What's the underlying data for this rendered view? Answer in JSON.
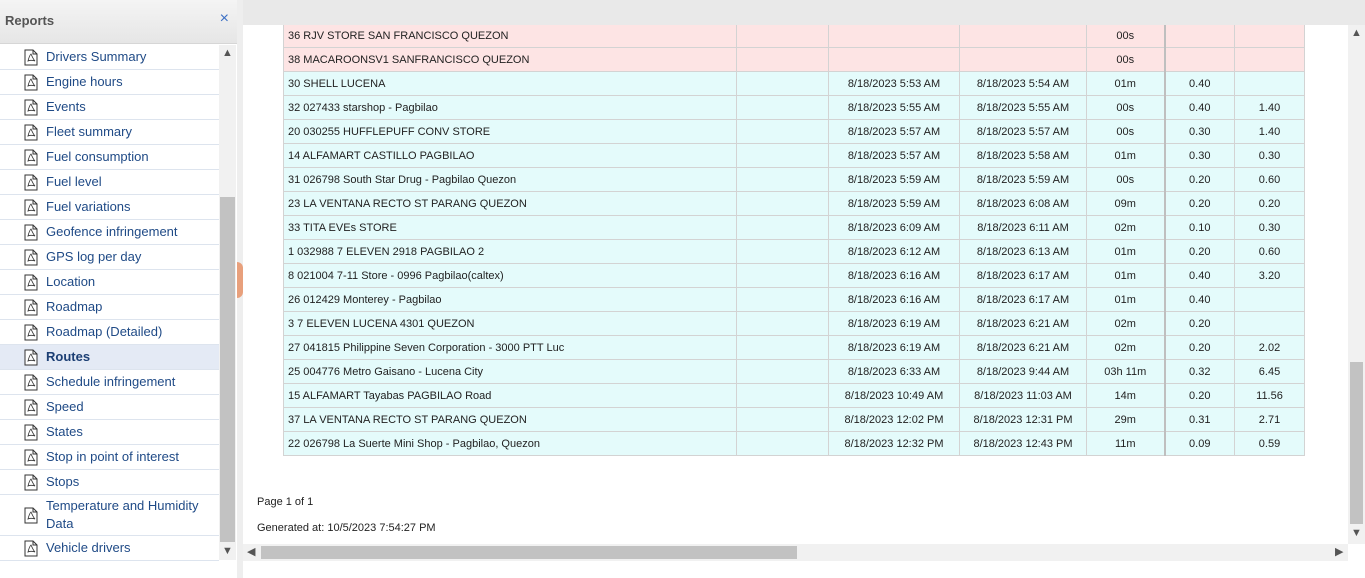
{
  "sidebar": {
    "title": "Reports",
    "close_glyph": "×",
    "items": [
      {
        "label": "Drivers Summary"
      },
      {
        "label": "Engine hours"
      },
      {
        "label": "Events"
      },
      {
        "label": "Fleet summary"
      },
      {
        "label": "Fuel consumption"
      },
      {
        "label": "Fuel level"
      },
      {
        "label": "Fuel variations"
      },
      {
        "label": "Geofence infringement"
      },
      {
        "label": "GPS log per day"
      },
      {
        "label": "Location"
      },
      {
        "label": "Roadmap"
      },
      {
        "label": "Roadmap (Detailed)"
      },
      {
        "label": "Routes",
        "selected": true
      },
      {
        "label": "Schedule infringement"
      },
      {
        "label": "Speed"
      },
      {
        "label": "States"
      },
      {
        "label": "Stop in point of interest"
      },
      {
        "label": "Stops"
      },
      {
        "label": "Temperature and Humidity Data"
      },
      {
        "label": "Vehicle drivers"
      }
    ],
    "icon": "pdf-file-icon"
  },
  "report": {
    "rows": [
      {
        "name": "36  RJV STORE SAN FRANCISCO QUEZON",
        "arrival": "",
        "departure": "",
        "duration": "00s",
        "col_a": "",
        "col_b": "",
        "status": "red"
      },
      {
        "name": "38  MACAROONSV1 SANFRANCISCO QUEZON",
        "arrival": "",
        "departure": "",
        "duration": "00s",
        "col_a": "",
        "col_b": "",
        "status": "red"
      },
      {
        "name": "30  SHELL LUCENA",
        "arrival": "8/18/2023 5:53 AM",
        "departure": "8/18/2023 5:54 AM",
        "duration": "01m",
        "col_a": "0.40",
        "col_b": "",
        "status": "cyan"
      },
      {
        "name": "32  027433 starshop - Pagbilao",
        "arrival": "8/18/2023 5:55 AM",
        "departure": "8/18/2023 5:55 AM",
        "duration": "00s",
        "col_a": "0.40",
        "col_b": "1.40",
        "status": "cyan"
      },
      {
        "name": "20  030255 HUFFLEPUFF CONV STORE",
        "arrival": "8/18/2023 5:57 AM",
        "departure": "8/18/2023 5:57 AM",
        "duration": "00s",
        "col_a": "0.30",
        "col_b": "1.40",
        "status": "cyan"
      },
      {
        "name": "14  ALFAMART CASTILLO PAGBILAO",
        "arrival": "8/18/2023 5:57 AM",
        "departure": "8/18/2023 5:58 AM",
        "duration": "01m",
        "col_a": "0.30",
        "col_b": "0.30",
        "status": "cyan"
      },
      {
        "name": "31  026798 South Star Drug - Pagbilao Quezon",
        "arrival": "8/18/2023 5:59 AM",
        "departure": "8/18/2023 5:59 AM",
        "duration": "00s",
        "col_a": "0.20",
        "col_b": "0.60",
        "status": "cyan"
      },
      {
        "name": "23  LA VENTANA RECTO ST PARANG QUEZON",
        "arrival": "8/18/2023 5:59 AM",
        "departure": "8/18/2023 6:08 AM",
        "duration": "09m",
        "col_a": "0.20",
        "col_b": "0.20",
        "status": "cyan"
      },
      {
        "name": "33  TITA EVEs STORE",
        "arrival": "8/18/2023 6:09 AM",
        "departure": "8/18/2023 6:11 AM",
        "duration": "02m",
        "col_a": "0.10",
        "col_b": "0.30",
        "status": "cyan"
      },
      {
        "name": "1  032988 7 ELEVEN 2918 PAGBILAO 2",
        "arrival": "8/18/2023 6:12 AM",
        "departure": "8/18/2023 6:13 AM",
        "duration": "01m",
        "col_a": "0.20",
        "col_b": "0.60",
        "status": "cyan"
      },
      {
        "name": "8  021004 7-11 Store - 0996 Pagbilao(caltex)",
        "arrival": "8/18/2023 6:16 AM",
        "departure": "8/18/2023 6:17 AM",
        "duration": "01m",
        "col_a": "0.40",
        "col_b": "3.20",
        "status": "cyan"
      },
      {
        "name": "26  012429 Monterey - Pagbilao",
        "arrival": "8/18/2023 6:16 AM",
        "departure": "8/18/2023 6:17 AM",
        "duration": "01m",
        "col_a": "0.40",
        "col_b": "",
        "status": "cyan"
      },
      {
        "name": "3  7 ELEVEN LUCENA 4301 QUEZON",
        "arrival": "8/18/2023 6:19 AM",
        "departure": "8/18/2023 6:21 AM",
        "duration": "02m",
        "col_a": "0.20",
        "col_b": "",
        "status": "cyan"
      },
      {
        "name": "27  041815 Philippine Seven Corporation - 3000 PTT Luc",
        "arrival": "8/18/2023 6:19 AM",
        "departure": "8/18/2023 6:21 AM",
        "duration": "02m",
        "col_a": "0.20",
        "col_b": "2.02",
        "status": "cyan"
      },
      {
        "name": "25  004776 Metro Gaisano - Lucena City",
        "arrival": "8/18/2023 6:33 AM",
        "departure": "8/18/2023 9:44 AM",
        "duration": "03h 11m",
        "col_a": "0.32",
        "col_b": "6.45",
        "status": "cyan"
      },
      {
        "name": "15  ALFAMART Tayabas PAGBILAO Road",
        "arrival": "8/18/2023 10:49 AM",
        "departure": "8/18/2023 11:03 AM",
        "duration": "14m",
        "col_a": "0.20",
        "col_b": "11.56",
        "status": "cyan"
      },
      {
        "name": "37  LA VENTANA RECTO ST PARANG QUEZON",
        "arrival": "8/18/2023 12:02 PM",
        "departure": "8/18/2023 12:31 PM",
        "duration": "29m",
        "col_a": "0.31",
        "col_b": "2.71",
        "status": "cyan"
      },
      {
        "name": "22  026798 La Suerte Mini Shop - Pagbilao, Quezon",
        "arrival": "8/18/2023 12:32 PM",
        "departure": "8/18/2023 12:43 PM",
        "duration": "11m",
        "col_a": "0.09",
        "col_b": "0.59",
        "status": "cyan"
      }
    ],
    "page_info": "Page 1 of 1",
    "generated_label": "Generated at:",
    "generated_value": "10/5/2023 7:54:27 PM"
  },
  "colors": {
    "row_red": "#fde4e4",
    "row_cyan": "#e4fbfb",
    "link_blue": "#1f4a86",
    "selected_bg": "#e4eaf5",
    "splitter_handle": "#e8a07c"
  }
}
